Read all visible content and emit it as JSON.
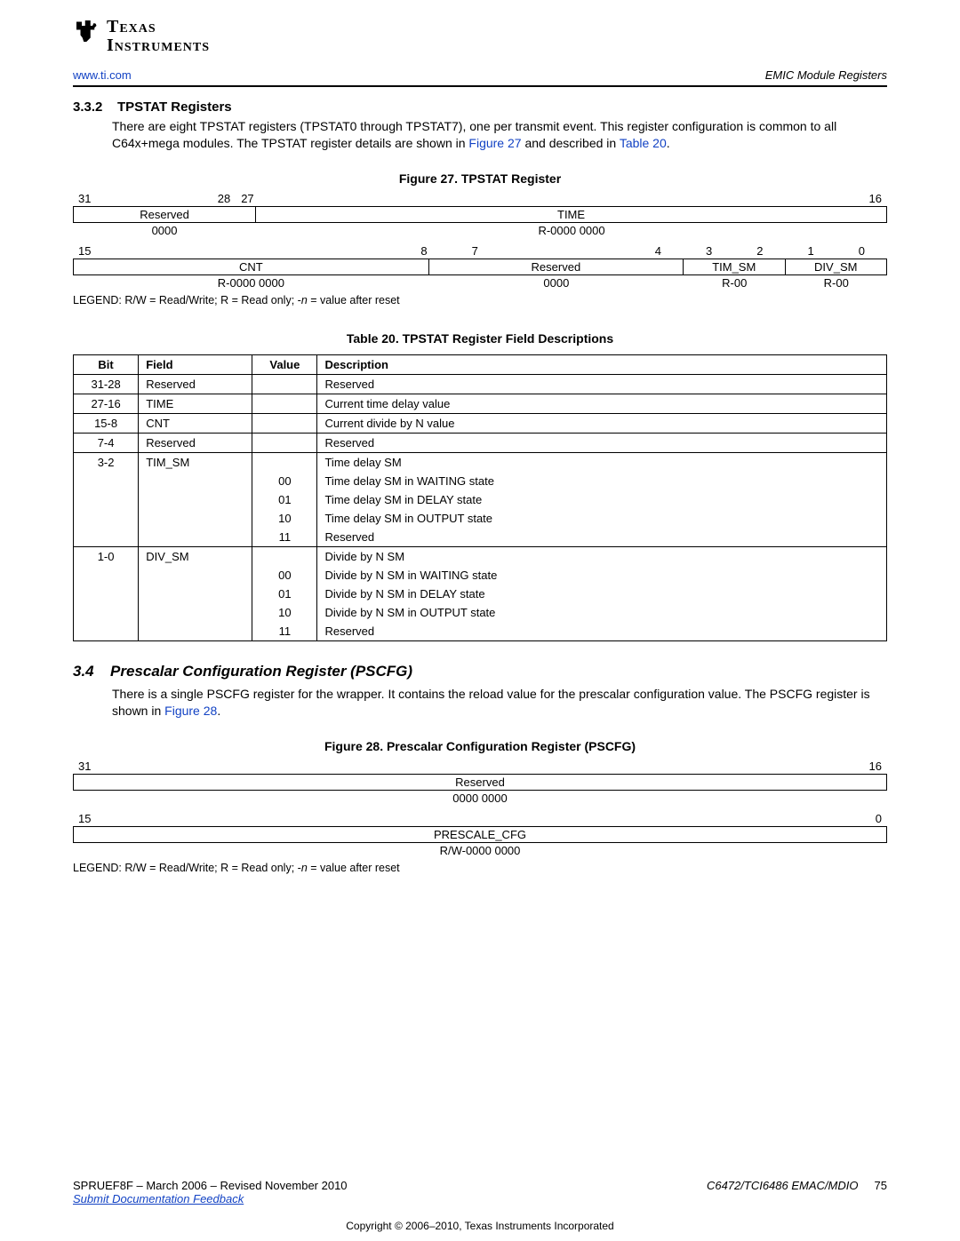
{
  "header": {
    "url": "www.ti.com",
    "chapter": "EMIC Module Registers",
    "logo_line1": "Texas",
    "logo_line2": "Instruments"
  },
  "sec332": {
    "num": "3.3.2",
    "title": "TPSTAT Registers",
    "para_a": "There are eight TPSTAT registers (TPSTAT0 through TPSTAT7), one per transmit event. This register configuration is common to all C64x+mega modules. The TPSTAT register details are shown in ",
    "fig_link": "Figure 27",
    "para_b": " and described in ",
    "tbl_link": "Table 20",
    "para_c": "."
  },
  "fig27": {
    "caption": "Figure 27. TPSTAT Register",
    "top_bits": {
      "b31": "31",
      "b28": "28",
      "b27": "27",
      "b16": "16"
    },
    "row1": {
      "reserved": "Reserved",
      "time": "TIME"
    },
    "row1_reset": {
      "reserved": "0000",
      "time": "R-0000 0000"
    },
    "bot_bits": {
      "b15": "15",
      "b8": "8",
      "b7": "7",
      "b4": "4",
      "b3": "3",
      "b2": "2",
      "b1": "1",
      "b0": "0"
    },
    "row2": {
      "cnt": "CNT",
      "reserved": "Reserved",
      "tim_sm": "TIM_SM",
      "div_sm": "DIV_SM"
    },
    "row2_reset": {
      "cnt": "R-0000 0000",
      "reserved": "0000",
      "tim_sm": "R-00",
      "div_sm": "R-00"
    },
    "legend_a": "LEGEND: R/W = Read/Write; R = Read only; -",
    "legend_i": "n",
    "legend_b": " = value after reset"
  },
  "tbl20": {
    "caption": "Table 20. TPSTAT Register Field Descriptions",
    "head": {
      "bit": "Bit",
      "field": "Field",
      "value": "Value",
      "desc": "Description"
    },
    "rows": [
      {
        "bit": "31-28",
        "field": "Reserved",
        "value": "",
        "desc": "Reserved"
      },
      {
        "bit": "27-16",
        "field": "TIME",
        "value": "",
        "desc": "Current time delay value"
      },
      {
        "bit": "15-8",
        "field": "CNT",
        "value": "",
        "desc": "Current divide by N value"
      },
      {
        "bit": "7-4",
        "field": "Reserved",
        "value": "",
        "desc": "Reserved"
      }
    ],
    "tim_sm": {
      "bit": "3-2",
      "field": "TIM_SM",
      "desc": "Time delay SM",
      "subs": [
        {
          "value": "00",
          "desc": "Time delay SM in WAITING state"
        },
        {
          "value": "01",
          "desc": "Time delay SM in DELAY state"
        },
        {
          "value": "10",
          "desc": "Time delay SM in OUTPUT state"
        },
        {
          "value": "11",
          "desc": "Reserved"
        }
      ]
    },
    "div_sm": {
      "bit": "1-0",
      "field": "DIV_SM",
      "desc": "Divide by N SM",
      "subs": [
        {
          "value": "00",
          "desc": "Divide by N SM in WAITING state"
        },
        {
          "value": "01",
          "desc": "Divide by N SM in DELAY state"
        },
        {
          "value": "10",
          "desc": "Divide by N SM in OUTPUT state"
        },
        {
          "value": "11",
          "desc": "Reserved"
        }
      ]
    }
  },
  "sec34": {
    "num": "3.4",
    "title": "Prescalar Configuration Register (PSCFG)",
    "para_a": "There is a single PSCFG register for the wrapper. It contains the reload value for the prescalar configuration value. The PSCFG register is shown in ",
    "fig_link": "Figure 28",
    "para_b": "."
  },
  "fig28": {
    "caption": "Figure 28. Prescalar Configuration Register (PSCFG)",
    "bits": {
      "b31": "31",
      "b16": "16",
      "b15": "15",
      "b0": "0"
    },
    "row1": {
      "label": "Reserved",
      "reset": "0000 0000"
    },
    "row2": {
      "label": "PRESCALE_CFG",
      "reset": "R/W-0000 0000"
    },
    "legend_a": "LEGEND: R/W = Read/Write; R = Read only; -",
    "legend_i": "n",
    "legend_b": " = value after reset"
  },
  "footer": {
    "doc": "SPRUEF8F – March 2006 – Revised November 2010",
    "title": "C6472/TCI6486 EMAC/MDIO",
    "page": "75",
    "feedback": "Submit Documentation Feedback",
    "copyright": "Copyright © 2006–2010, Texas Instruments Incorporated"
  }
}
